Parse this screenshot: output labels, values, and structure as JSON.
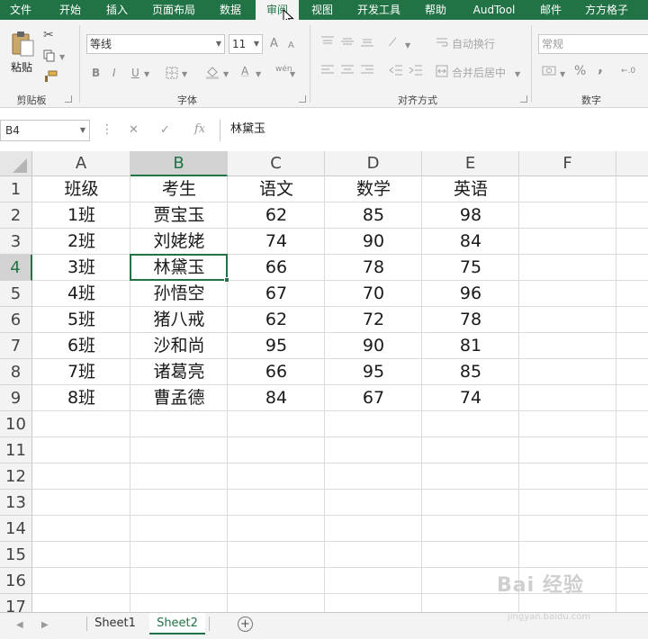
{
  "ribbon_tabs": [
    "文件",
    "开始",
    "插入",
    "页面布局",
    "数据",
    "审阅",
    "视图",
    "开发工具",
    "帮助",
    "AudTool",
    "邮件",
    "方方格子"
  ],
  "active_tab": "审阅",
  "colors": {
    "brand": "#217346",
    "selection": "#217346",
    "header_bg": "#f3f3f3"
  },
  "clipboard": {
    "paste_label": "粘贴",
    "group_label": "剪贴板",
    "icons": [
      "paste-icon",
      "cut-icon",
      "copy-icon",
      "format-painter-icon"
    ]
  },
  "font": {
    "name_value": "等线",
    "size_value": "11",
    "group_label": "字体",
    "icons": [
      "bold-icon",
      "italic-icon",
      "underline-icon",
      "border-icon",
      "fill-color-icon",
      "font-color-icon",
      "phonetic-icon",
      "increase-font-icon",
      "decrease-font-icon"
    ],
    "glyphs": {
      "bold": "B",
      "italic": "I",
      "underline": "U",
      "grow": "A",
      "shrink": "A",
      "phonetic": "wén"
    }
  },
  "alignment": {
    "wrap_text_label": "自动换行",
    "merge_label": "合并后居中",
    "group_label": "对齐方式"
  },
  "number": {
    "format_value": "常规",
    "group_label": "数字",
    "percent": "%",
    "comma": ","
  },
  "formula_bar": {
    "name_box": "B4",
    "fx": "fx",
    "content": "林黛玉"
  },
  "sheet": {
    "columns": [
      "A",
      "B",
      "C",
      "D",
      "E",
      "F"
    ],
    "row_numbers": [
      "1",
      "2",
      "3",
      "4",
      "5",
      "6",
      "7",
      "8",
      "9",
      "10",
      "11",
      "12",
      "13",
      "14",
      "15",
      "16",
      "17"
    ],
    "selected_cell": "B4",
    "rows": [
      [
        "班级",
        "考生",
        "语文",
        "数学",
        "英语"
      ],
      [
        "1班",
        "贾宝玉",
        "62",
        "85",
        "98"
      ],
      [
        "2班",
        "刘姥姥",
        "74",
        "90",
        "84"
      ],
      [
        "3班",
        "林黛玉",
        "66",
        "78",
        "75"
      ],
      [
        "4班",
        "孙悟空",
        "67",
        "70",
        "96"
      ],
      [
        "5班",
        "猪八戒",
        "62",
        "72",
        "78"
      ],
      [
        "6班",
        "沙和尚",
        "95",
        "90",
        "81"
      ],
      [
        "7班",
        "诸葛亮",
        "66",
        "95",
        "85"
      ],
      [
        "8班",
        "曹孟德",
        "84",
        "67",
        "74"
      ]
    ]
  },
  "sheet_tabs": [
    "Sheet1",
    "Sheet2"
  ],
  "active_sheet": "Sheet2",
  "add_sheet": "+",
  "watermark": {
    "brand": "Bai 经验",
    "url": "jingyan.baidu.com"
  }
}
